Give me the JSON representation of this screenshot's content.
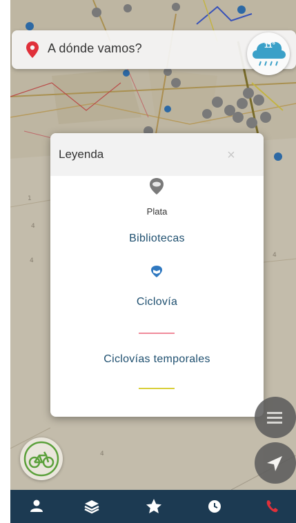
{
  "search": {
    "placeholder": "A dónde vamos?"
  },
  "weather": {
    "temperature": "11°"
  },
  "legend": {
    "title": "Leyenda",
    "close_glyph": "×",
    "items": [
      {
        "label": "Plata",
        "icon": "plata-marker-icon"
      },
      {
        "label": "Bibliotecas",
        "icon": "library-marker-icon"
      },
      {
        "label": "Ciclovía",
        "line_color": "#f08a9a"
      },
      {
        "label": "Ciclovías temporales",
        "line_color": "#d9cf3a"
      }
    ]
  },
  "bottom_nav": {
    "items": [
      {
        "name": "profile",
        "icon": "user-icon"
      },
      {
        "name": "layers",
        "icon": "layers-icon"
      },
      {
        "name": "favorites",
        "icon": "star-icon"
      },
      {
        "name": "history",
        "icon": "clock-icon"
      },
      {
        "name": "emergency-call",
        "icon": "phone-icon"
      }
    ]
  },
  "colors": {
    "nav_bg": "#1c3a52",
    "accent_red": "#e0303a",
    "legend_text": "#1e4f6f"
  }
}
